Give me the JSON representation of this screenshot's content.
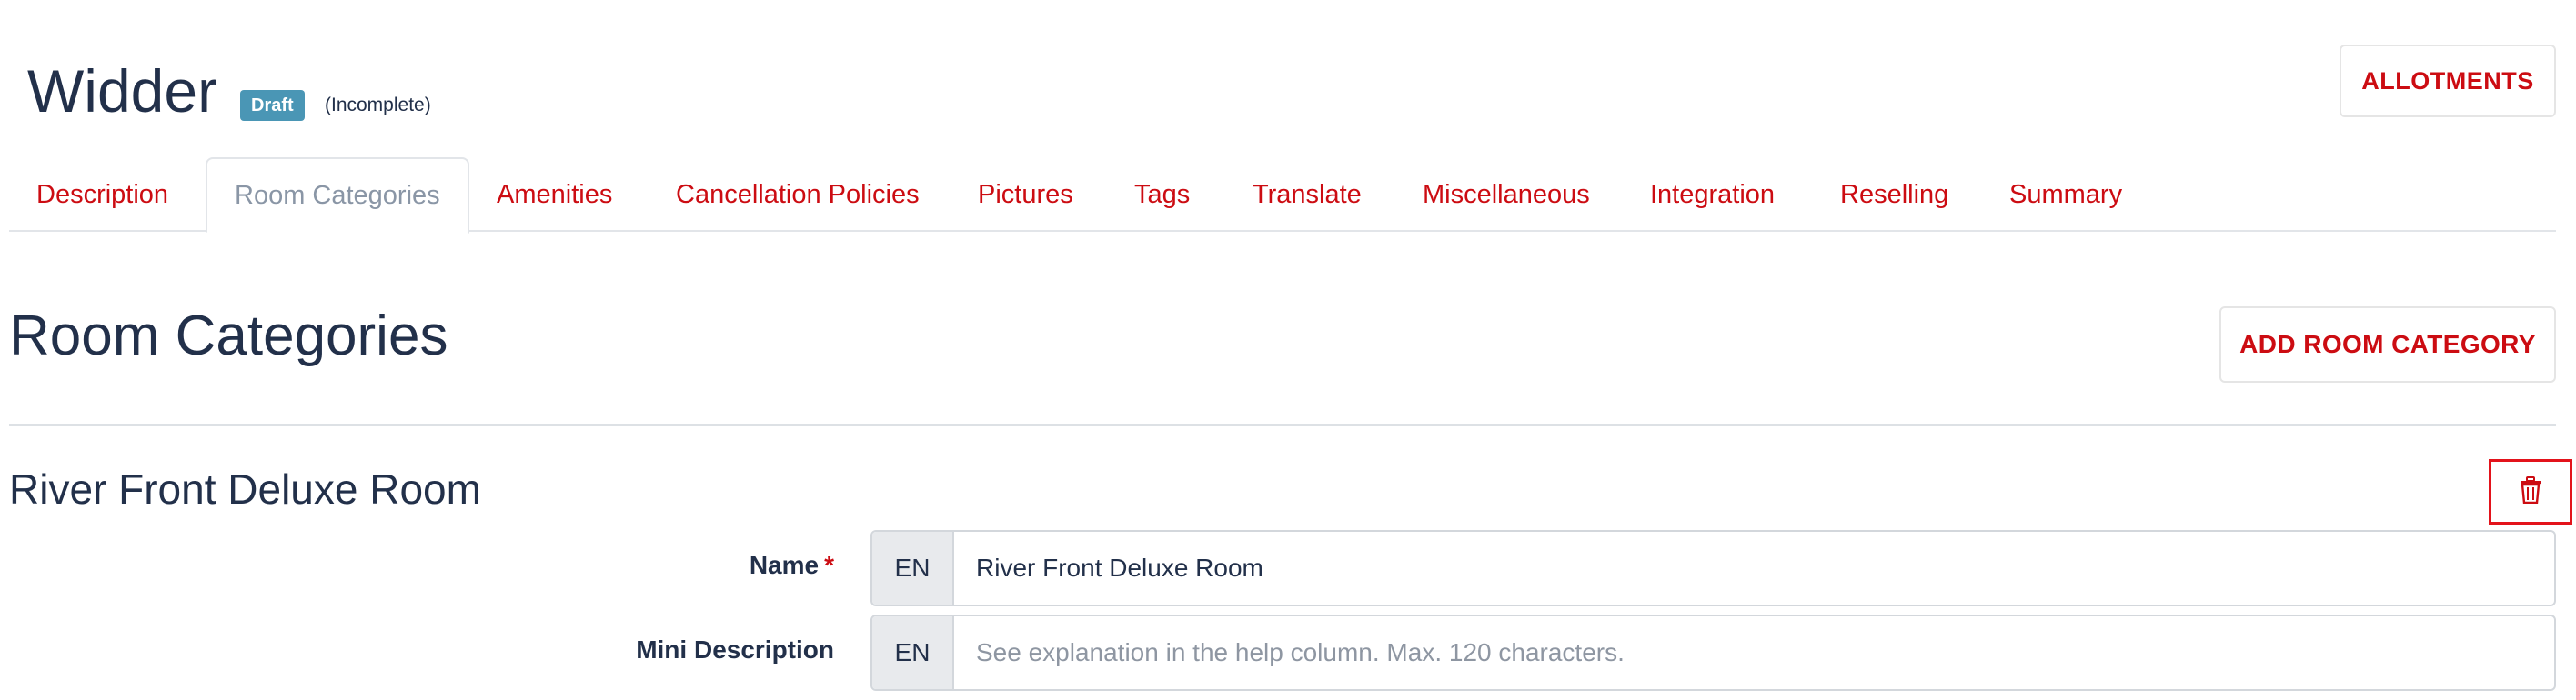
{
  "header": {
    "hotel_name": "Widder",
    "status_badge": "Draft",
    "completeness": "(Incomplete)",
    "allotments_label": "ALLOTMENTS"
  },
  "tabs": [
    {
      "label": "Description",
      "active": false
    },
    {
      "label": "Room Categories",
      "active": true
    },
    {
      "label": "Amenities",
      "active": false
    },
    {
      "label": "Cancellation Policies",
      "active": false
    },
    {
      "label": "Pictures",
      "active": false
    },
    {
      "label": "Tags",
      "active": false
    },
    {
      "label": "Translate",
      "active": false
    },
    {
      "label": "Miscellaneous",
      "active": false
    },
    {
      "label": "Integration",
      "active": false
    },
    {
      "label": "Reselling",
      "active": false
    },
    {
      "label": "Summary",
      "active": false
    }
  ],
  "section": {
    "title": "Room Categories",
    "add_button_label": "ADD ROOM CATEGORY"
  },
  "room": {
    "title": "River Front Deluxe Room",
    "delete_icon": "trash-icon",
    "fields": {
      "name": {
        "label": "Name",
        "required_marker": "*",
        "lang": "EN",
        "value": "River Front Deluxe Room",
        "placeholder": ""
      },
      "mini_description": {
        "label": "Mini Description",
        "lang": "EN",
        "value": "",
        "placeholder": "See explanation in the help column. Max. 120 characters."
      }
    }
  },
  "colors": {
    "brand_red": "#cc0c12",
    "badge_blue": "#4a96b5",
    "text_dark": "#22304a",
    "tab_inactive_muted": "#8a96a6",
    "highlight_red": "#e3131b"
  }
}
